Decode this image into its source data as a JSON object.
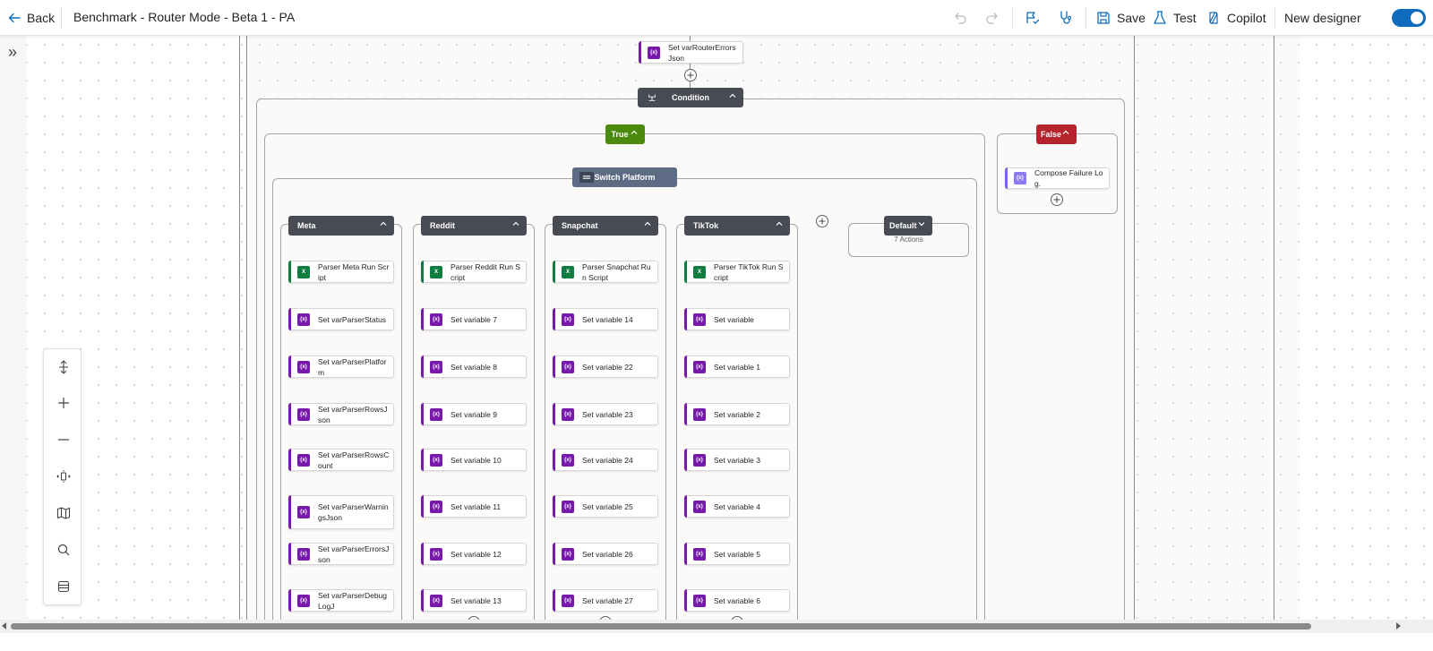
{
  "topbar": {
    "back_label": "Back",
    "flow_title": "Benchmark - Router Mode - Beta 1 - PA",
    "save_label": "Save",
    "test_label": "Test",
    "copilot_label": "Copilot",
    "new_designer_label": "New designer",
    "new_designer_enabled": true
  },
  "flow": {
    "top_action": "Set varRouterErrorsJson",
    "condition_label": "Condition",
    "true_label": "True",
    "false_label": "False",
    "switch_label": "Switch Platform",
    "false_action": "Compose Failure Log.",
    "default_case": {
      "label": "Default",
      "summary": "7 Actions"
    },
    "cases": [
      {
        "label": "Meta",
        "actions": [
          {
            "type": "excel",
            "label": "Parser Meta Run Script"
          },
          {
            "type": "variable",
            "label": "Set varParserStatus"
          },
          {
            "type": "variable",
            "label": "Set varParserPlatform"
          },
          {
            "type": "variable",
            "label": "Set varParserRowsJson"
          },
          {
            "type": "variable",
            "label": "Set varParserRowsCount"
          },
          {
            "type": "variable",
            "label": "Set varParserWarningsJson"
          },
          {
            "type": "variable",
            "label": "Set varParserErrorsJson"
          },
          {
            "type": "variable",
            "label": "Set varParserDebugLogJ"
          }
        ]
      },
      {
        "label": "Reddit",
        "actions": [
          {
            "type": "excel",
            "label": "Parser Reddit Run Script"
          },
          {
            "type": "variable",
            "label": "Set variable 7"
          },
          {
            "type": "variable",
            "label": "Set variable 8"
          },
          {
            "type": "variable",
            "label": "Set variable 9"
          },
          {
            "type": "variable",
            "label": "Set variable 10"
          },
          {
            "type": "variable",
            "label": "Set variable 11"
          },
          {
            "type": "variable",
            "label": "Set variable 12"
          },
          {
            "type": "variable",
            "label": "Set variable 13"
          }
        ]
      },
      {
        "label": "Snapchat",
        "actions": [
          {
            "type": "excel",
            "label": "Parser Snapchat Run Script"
          },
          {
            "type": "variable",
            "label": "Set variable 14"
          },
          {
            "type": "variable",
            "label": "Set variable 22"
          },
          {
            "type": "variable",
            "label": "Set variable 23"
          },
          {
            "type": "variable",
            "label": "Set variable 24"
          },
          {
            "type": "variable",
            "label": "Set variable 25"
          },
          {
            "type": "variable",
            "label": "Set variable 26"
          },
          {
            "type": "variable",
            "label": "Set variable 27"
          }
        ]
      },
      {
        "label": "TikTok",
        "actions": [
          {
            "type": "excel",
            "label": "Parser TikTok Run Script"
          },
          {
            "type": "variable",
            "label": "Set variable"
          },
          {
            "type": "variable",
            "label": "Set variable 1"
          },
          {
            "type": "variable",
            "label": "Set variable 2"
          },
          {
            "type": "variable",
            "label": "Set variable 3"
          },
          {
            "type": "variable",
            "label": "Set variable 4"
          },
          {
            "type": "variable",
            "label": "Set variable 5"
          },
          {
            "type": "variable",
            "label": "Set variable 6"
          }
        ]
      }
    ]
  },
  "icons": {
    "back": "arrow-left-icon",
    "undo": "undo-icon",
    "redo": "redo-icon",
    "flow_checker": "flow-checker-icon",
    "health": "stethoscope-icon",
    "save": "save-icon",
    "test": "flask-icon",
    "copilot": "copilot-icon",
    "variable": "variable-icon",
    "excel": "excel-icon",
    "compose": "compose-icon"
  },
  "colors": {
    "accent": "#0f6cbd",
    "true_branch": "#4c8a0e",
    "false_branch": "#b5242c",
    "variable_action": "#7719aa",
    "excel_action": "#107c41",
    "switch": "#5d6b84",
    "case_header": "#484b53"
  }
}
